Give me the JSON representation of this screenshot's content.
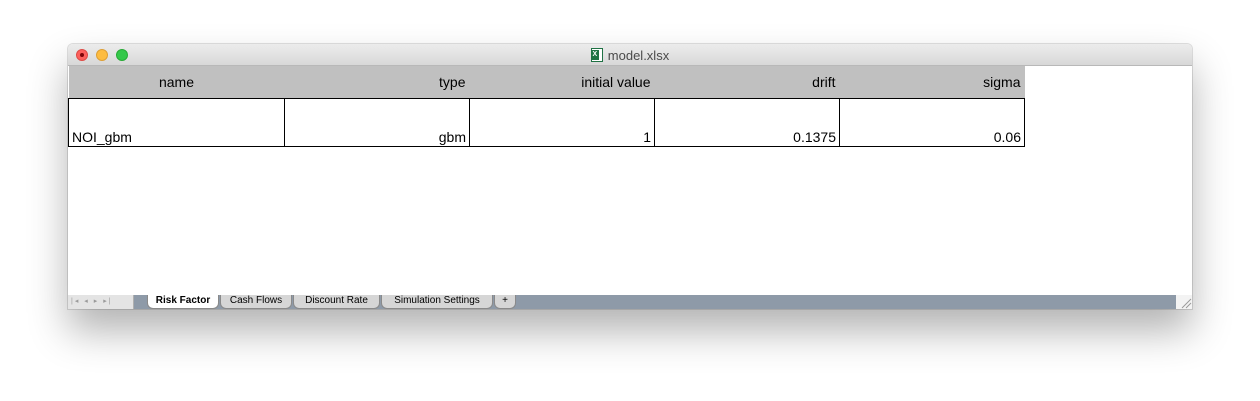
{
  "window": {
    "title": "model.xlsx",
    "file_icon": "excel-file-icon"
  },
  "sheet": {
    "columns": [
      "name",
      "type",
      "initial value",
      "drift",
      "sigma"
    ],
    "rows": [
      [
        "NOI_gbm",
        "gbm",
        "1",
        "0.1375",
        "0.06"
      ]
    ]
  },
  "tabs": {
    "nav_arrows": "|◂ ◂ ▸ ▸|",
    "items": [
      "Risk Factor",
      "Cash Flows",
      "Discount Rate",
      "Simulation Settings"
    ],
    "active": "Risk Factor",
    "add_label": "+"
  },
  "colors": {
    "header_bg": "#c0c0c0",
    "tabbar_bg": "#8e9aa8",
    "close": "#fc605c",
    "minimize": "#fdbc40",
    "maximize": "#34c84a"
  }
}
